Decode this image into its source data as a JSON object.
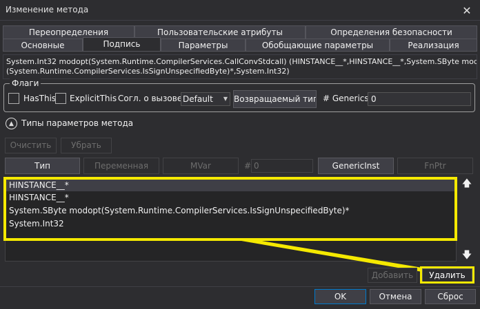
{
  "window": {
    "title": "Изменение метода",
    "close_glyph": "✕"
  },
  "tabs_row1": [
    "Переопределения",
    "Пользовательские атрибуты",
    "Определения безопасности"
  ],
  "tabs_row2": [
    "Основные",
    "Подпись",
    "Параметры",
    "Обобщающие параметры",
    "Реализация"
  ],
  "active_tab": "Подпись",
  "signature": {
    "line1": "System.Int32 modopt(System.Runtime.CompilerServices.CallConvStdcall) (HINSTANCE__*,HINSTANCE__*,System.SByte modopt",
    "line2": "(System.Runtime.CompilerServices.IsSignUnspecifiedByte)*,System.Int32)"
  },
  "flags": {
    "label": "Флаги",
    "hasthis_label": "HasThis",
    "explicitthis_label": "ExplicitThis",
    "callconv_label": "Согл. о вызове",
    "callconv_value": "Default",
    "return_type_button": "Возвращаемый тип...",
    "generics_label": "# Generics",
    "generics_value": "0"
  },
  "param_types": {
    "expander_label": "Типы параметров метода",
    "expander_icon": "chevron-up-icon",
    "clear_button": "Очистить",
    "remove_button": "Убрать",
    "type_button": "Тип",
    "variable_button": "Переменная",
    "mvar_button": "MVar",
    "hash_label": "#",
    "index_value": "0",
    "genericinst_button": "GenericInst",
    "fnptr_button": "FnPtr",
    "items": [
      "HINSTANCE__*",
      "HINSTANCE__*",
      "System.SByte modopt(System.Runtime.CompilerServices.IsSignUnspecifiedByte)*",
      "System.Int32"
    ],
    "move_up_icon": "arrow-up-icon",
    "move_down_icon": "arrow-down-icon",
    "add_button": "Добавить",
    "delete_button": "Удалить"
  },
  "footer": {
    "ok": "OK",
    "cancel": "Отмена",
    "reset": "Сброс"
  },
  "colors": {
    "background": "#2d2d30",
    "highlight": "#f5e900",
    "button": "#3f3f46"
  }
}
